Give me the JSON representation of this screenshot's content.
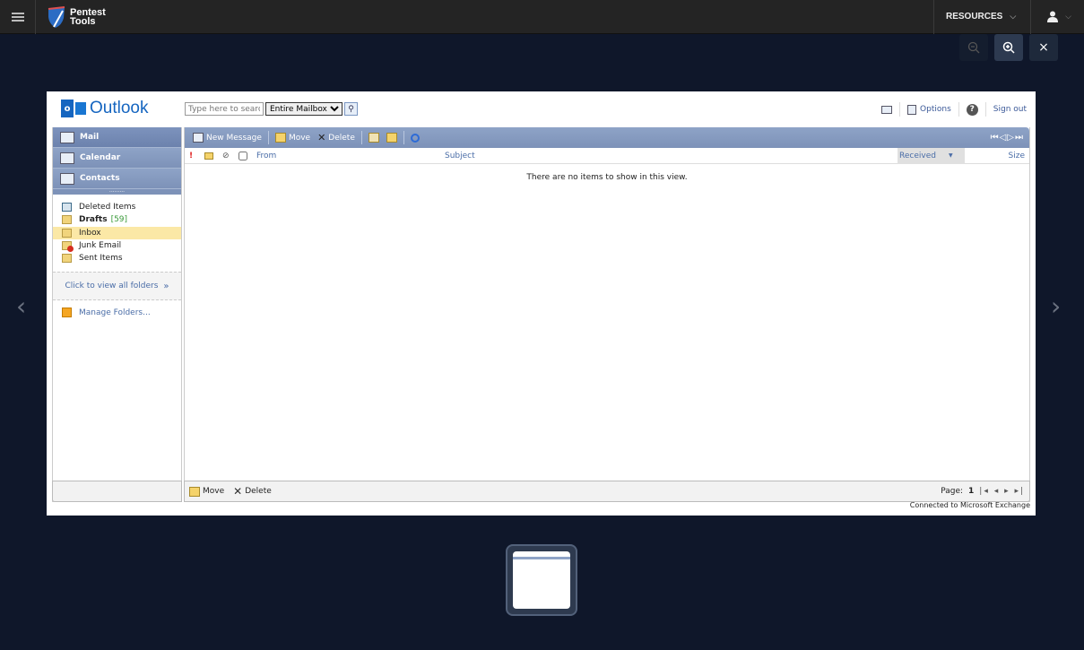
{
  "topbar": {
    "brand_line1": "Pentest",
    "brand_line2": "Tools",
    "resources_label": "RESOURCES"
  },
  "viewer": {
    "zoom_out": "zoom-out",
    "zoom_in": "zoom-in",
    "close": "×",
    "prev": "‹",
    "next": "›"
  },
  "outlook": {
    "logo_text": "Outlook",
    "search": {
      "placeholder": "Type here to search",
      "scope": "Entire Mailbox"
    },
    "header_links": {
      "options": "Options",
      "help": "?",
      "sign_out": "Sign out"
    },
    "nav": {
      "buttons": [
        {
          "label": "Mail"
        },
        {
          "label": "Calendar"
        },
        {
          "label": "Contacts"
        }
      ],
      "folders": [
        {
          "label": "Deleted Items",
          "count": ""
        },
        {
          "label": "Drafts",
          "count": "[59]"
        },
        {
          "label": "Inbox",
          "count": ""
        },
        {
          "label": "Junk Email",
          "count": ""
        },
        {
          "label": "Sent Items",
          "count": ""
        }
      ],
      "view_all": "Click to view all folders",
      "manage": "Manage Folders..."
    },
    "toolbar": {
      "new_message": "New Message",
      "move": "Move",
      "delete": "Delete"
    },
    "columns": {
      "importance": "!",
      "from": "From",
      "subject": "Subject",
      "received": "Received",
      "size": "Size"
    },
    "empty_message": "There are no items to show in this view.",
    "footer": {
      "move": "Move",
      "delete": "Delete",
      "page_label": "Page:",
      "page_number": "1"
    },
    "status": "Connected to Microsoft Exchange"
  }
}
